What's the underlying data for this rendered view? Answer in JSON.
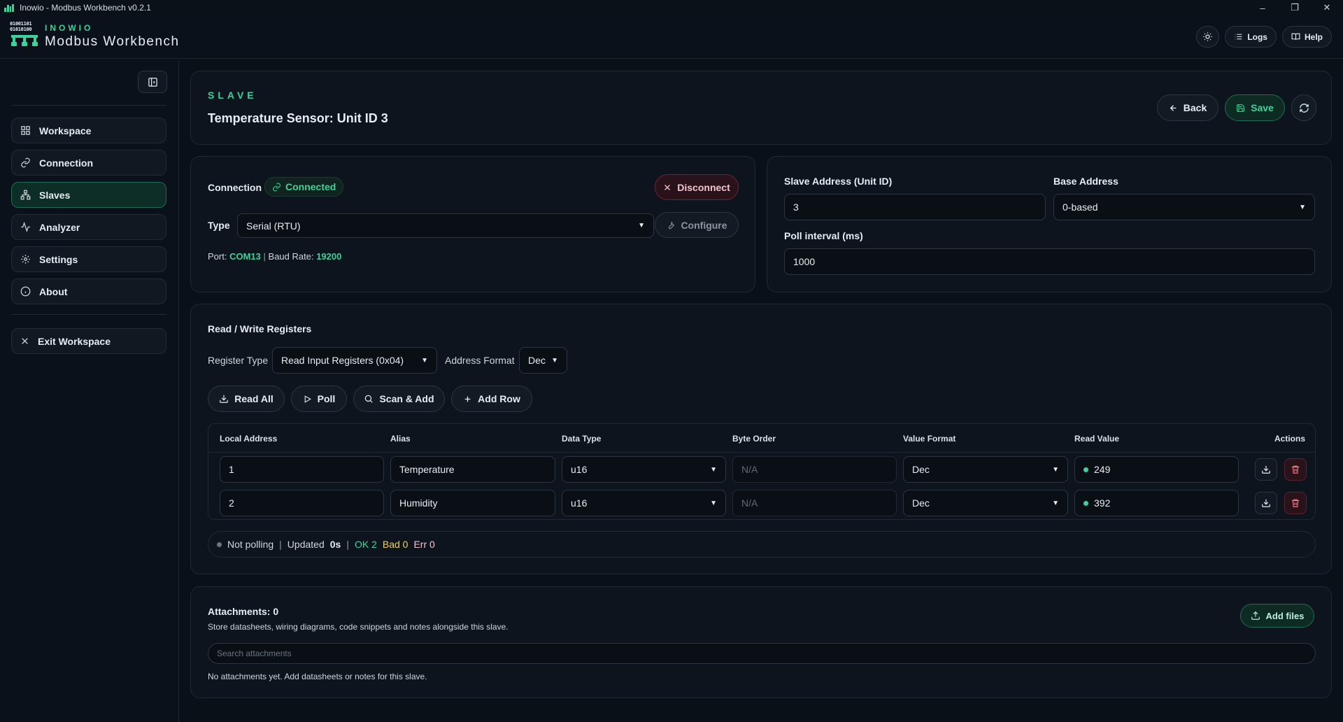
{
  "window": {
    "title": "Inowio - Modbus Workbench v0.2.1",
    "controls": [
      "–",
      "❐",
      "✕"
    ]
  },
  "header": {
    "logo_bits": [
      "01001101",
      "01010100"
    ],
    "brand_kicker": "INOWIO",
    "brand_title": "Modbus Workbench",
    "logs_label": "Logs",
    "help_label": "Help"
  },
  "sidebar": {
    "items": [
      {
        "label": "Workspace",
        "icon": "grid-icon",
        "active": false
      },
      {
        "label": "Connection",
        "icon": "link-icon",
        "active": false
      },
      {
        "label": "Slaves",
        "icon": "network-icon",
        "active": true
      },
      {
        "label": "Analyzer",
        "icon": "pulse-icon",
        "active": false
      },
      {
        "label": "Settings",
        "icon": "gear-icon",
        "active": false
      },
      {
        "label": "About",
        "icon": "info-icon",
        "active": false
      }
    ],
    "exit_label": "Exit Workspace"
  },
  "page": {
    "kicker": "SLAVE",
    "title": "Temperature Sensor: Unit ID 3",
    "back_label": "Back",
    "save_label": "Save"
  },
  "connection": {
    "label": "Connection",
    "status": "Connected",
    "disconnect_label": "Disconnect",
    "type_label": "Type",
    "type_value": "Serial (RTU)",
    "configure_label": "Configure",
    "port_label": "Port:",
    "port_value": "COM13",
    "separator": "|",
    "baud_label": "Baud Rate:",
    "baud_value": "19200"
  },
  "slave_settings": {
    "address_label": "Slave Address (Unit ID)",
    "address_value": "3",
    "base_label": "Base Address",
    "base_value": "0-based",
    "poll_label": "Poll interval (ms)",
    "poll_value": "1000"
  },
  "registers": {
    "title": "Read / Write Registers",
    "register_type_label": "Register Type",
    "register_type_value": "Read Input Registers (0x04)",
    "address_format_label": "Address Format",
    "address_format_value": "Dec",
    "read_all_label": "Read All",
    "poll_label": "Poll",
    "scan_label": "Scan & Add",
    "add_row_label": "Add Row",
    "columns": [
      "Local Address",
      "Alias",
      "Data Type",
      "Byte Order",
      "Value Format",
      "Read Value",
      "Actions"
    ],
    "rows": [
      {
        "address": "1",
        "alias": "Temperature",
        "data_type": "u16",
        "byte_order": "N/A",
        "value_format": "Dec",
        "read_value": "249"
      },
      {
        "address": "2",
        "alias": "Humidity",
        "data_type": "u16",
        "byte_order": "N/A",
        "value_format": "Dec",
        "read_value": "392"
      }
    ],
    "status": {
      "polling": "Not polling",
      "sep": "|",
      "updated_label": "Updated",
      "updated_value": "0s",
      "ok": "OK 2",
      "bad": "Bad 0",
      "err": "Err 0"
    }
  },
  "attachments": {
    "title": "Attachments: 0",
    "description": "Store datasheets, wiring diagrams, code snippets and notes alongside this slave.",
    "add_label": "Add files",
    "search_placeholder": "Search attachments",
    "empty_text": "No attachments yet. Add datasheets or notes for this slave."
  },
  "colors": {
    "accent": "#3fd19a",
    "background": "#0a1018",
    "card": "#0e141d",
    "danger": "#f07a8a",
    "warning": "#e7d36a"
  }
}
